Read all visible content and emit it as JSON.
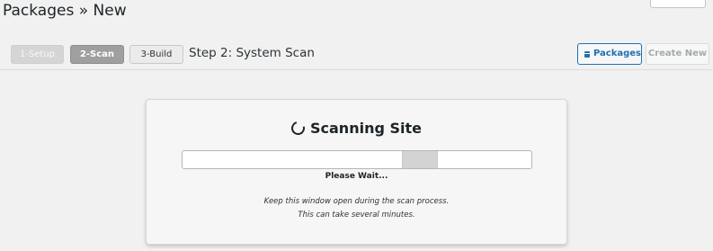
{
  "page": {
    "title": "Packages » New"
  },
  "steps": [
    {
      "label": "1-Setup",
      "state": "done"
    },
    {
      "label": "2-Scan",
      "state": "active"
    },
    {
      "label": "3-Build",
      "state": "pending"
    }
  ],
  "step_title": "Step 2: System Scan",
  "toolbar": {
    "packages_label": "Packages",
    "create_new_label": "Create New",
    "packages_icon": "package-icon"
  },
  "scan": {
    "heading": "Scanning Site",
    "status": "Please Wait...",
    "note_line1": "Keep this window open during the scan process.",
    "note_line2": "This can take several minutes.",
    "spinner_icon": "spinner-icon",
    "progress_indeterminate": true
  },
  "colors": {
    "accent": "#2271b1",
    "background": "#f1f1f1",
    "active_step": "#9f9f9f"
  }
}
